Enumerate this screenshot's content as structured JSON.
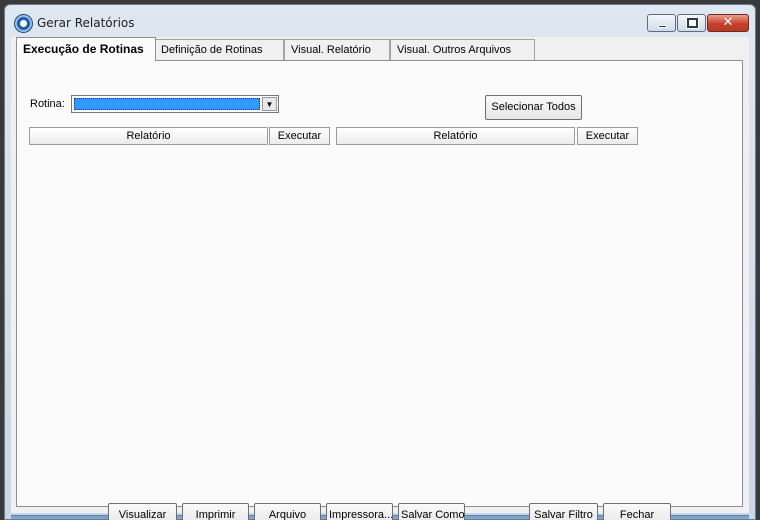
{
  "window": {
    "title": "Gerar Relatórios",
    "close_glyph": "✕"
  },
  "tabs": [
    {
      "label": "Execução de Rotinas",
      "active": true
    },
    {
      "label": "Definição de Rotinas",
      "active": false
    },
    {
      "label": "Visual. Relatório",
      "active": false
    },
    {
      "label": "Visual. Outros Arquivos",
      "active": false
    }
  ],
  "form": {
    "rotina_label": "Rotina:",
    "rotina_value": "",
    "select_all_label": "Selecionar Todos"
  },
  "grid": {
    "headers": [
      "Relatório",
      "Executar",
      "Relatório",
      "Executar"
    ]
  },
  "buttons": {
    "visualizar": "Visualizar",
    "imprimir": "Imprimir",
    "arquivo": "Arquivo",
    "impressora": "Impressora...",
    "salvar_como": "Salvar Como",
    "salvar_filtro": "Salvar Filtro",
    "fechar": "Fechar"
  },
  "colors": {
    "selection": "#3399ff",
    "close_button": "#c7412a"
  }
}
